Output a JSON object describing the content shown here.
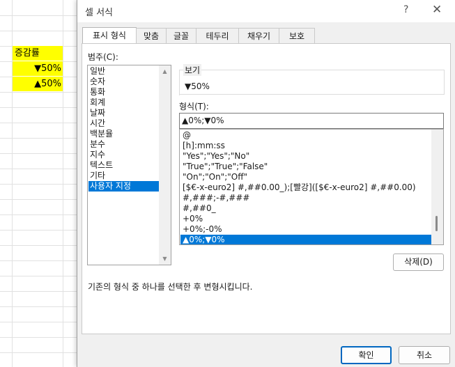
{
  "sheet": {
    "cells": [
      {
        "text": "증감률",
        "align": "left"
      },
      {
        "text": "▼50%",
        "align": "right"
      },
      {
        "text": "▲50%",
        "align": "right"
      }
    ]
  },
  "dialog": {
    "title": "셀 서식",
    "help": "?",
    "close": "✕",
    "tabs": [
      "표시 형식",
      "맞춤",
      "글꼴",
      "테두리",
      "채우기",
      "보호"
    ],
    "active_tab": "표시 형식",
    "category_label": "범주(C):",
    "categories": [
      "일반",
      "숫자",
      "통화",
      "회계",
      "날짜",
      "시간",
      "백분율",
      "분수",
      "지수",
      "텍스트",
      "기타",
      "사용자 지정"
    ],
    "selected_category": "사용자 지정",
    "sample_label": "보기",
    "sample_value": "▼50%",
    "type_label": "형식(T):",
    "type_value": "▲0%;▼0%",
    "formats": [
      "@",
      "[h]:mm:ss",
      "\"Yes\";\"Yes\";\"No\"",
      "\"True\";\"True\";\"False\"",
      "\"On\";\"On\";\"Off\"",
      "[$€-x-euro2] #,##0.00_);[빨강]([$€-x-euro2] #,##0.00)",
      "#,###;-#,###",
      "#,##0_",
      "+0%",
      "+0%;-0%",
      "▲0%;▼0%"
    ],
    "selected_format": "▲0%;▼0%",
    "delete_button": "삭제(D)",
    "description": "기존의 형식 중 하나를 선택한 후 변형시킵니다.",
    "ok_button": "확인",
    "cancel_button": "취소"
  },
  "colors": {
    "cell_fill": "#ffff00",
    "selection": "#0078d7",
    "primary_border": "#0067c0"
  }
}
